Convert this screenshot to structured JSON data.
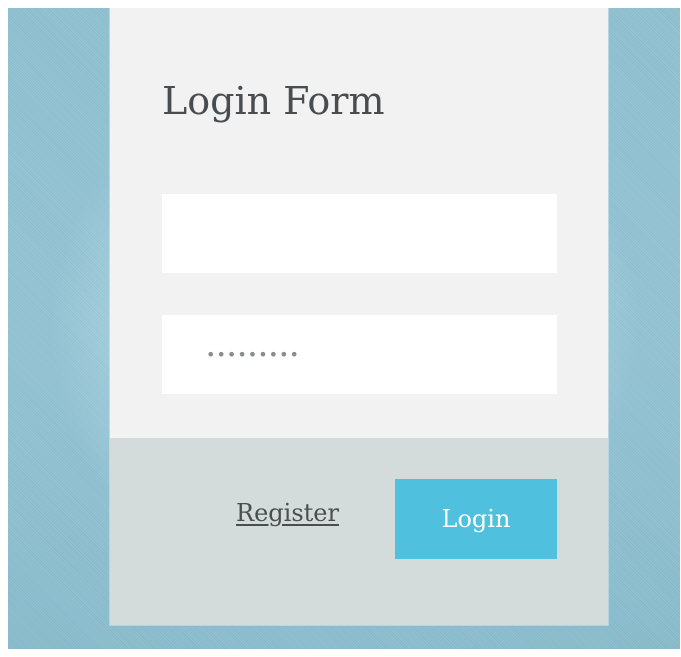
{
  "form": {
    "title": "Login Form",
    "username": {
      "value": "",
      "placeholder": ""
    },
    "password": {
      "value": "",
      "placeholder": "•••••••••"
    },
    "register_label": "Register",
    "login_label": "Login"
  },
  "colors": {
    "background": "#94c5d5",
    "card": "#f2f2f2",
    "footer": "#d3dbdb",
    "accent": "#4fc0dd",
    "text": "#4a4d4f"
  }
}
